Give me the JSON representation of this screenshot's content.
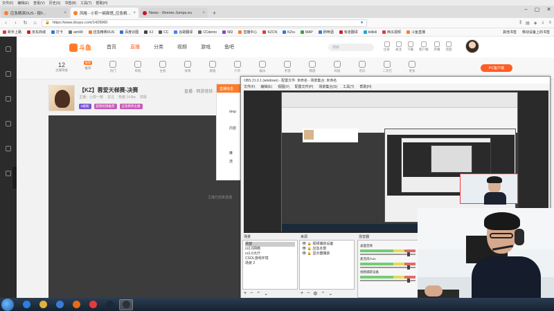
{
  "menubar": {
    "items": [
      "文件(F)",
      "编辑(E)",
      "查看(V)",
      "历史(S)",
      "书签(B)",
      "工具(T)",
      "帮助(H)"
    ]
  },
  "tabs": [
    {
      "label": "应急精英DUS - 按F...",
      "color": "#ff7b27",
      "active": false
    },
    {
      "label": "风格 - 小煎一碗面馆_应急精英...",
      "color": "#ff7b27",
      "active": true
    },
    {
      "label": "News - Xtreme-Jumps.eu",
      "color": "#c8102e",
      "active": false
    }
  ],
  "nav": {
    "url": "https://www.douyu.com/1429960",
    "back": "‹",
    "forward": "›",
    "reload": "↻",
    "home": "⌂",
    "new_tab": "+"
  },
  "bookmarks": {
    "items": [
      {
        "label": "新手上路",
        "color": "#e23b3b"
      },
      {
        "label": "京东商城",
        "color": "#d71e1e"
      },
      {
        "label": "打卡",
        "color": "#2f7bd9"
      },
      {
        "label": "aim99",
        "color": "#777777"
      },
      {
        "label": "应急精英DUS",
        "color": "#ff7b27"
      },
      {
        "label": "百度识图",
        "color": "#3a6fd8"
      },
      {
        "label": "XJ",
        "color": "#444444"
      },
      {
        "label": "CC",
        "color": "#5a5a5a"
      },
      {
        "label": "谷歌翻译",
        "color": "#4285f4"
      },
      {
        "label": "CCdemo",
        "color": "#6b6b6b"
      },
      {
        "label": "582",
        "color": "#8b3dd6"
      },
      {
        "label": "直播中心",
        "color": "#ff7b27"
      },
      {
        "label": "KZCN",
        "color": "#e23b3b"
      },
      {
        "label": "KZru",
        "color": "#2f7bd9"
      },
      {
        "label": "MAP",
        "color": "#3aa14a"
      },
      {
        "label": "刷啤酒",
        "color": "#2f7bd9"
      },
      {
        "label": "有道翻译",
        "color": "#d71e1e"
      },
      {
        "label": "bilibili",
        "color": "#22a6d8"
      },
      {
        "label": "西瓜视频",
        "color": "#e23b3b"
      },
      {
        "label": "斗鱼直播",
        "color": "#ff7b27"
      }
    ],
    "right": [
      "其他书签",
      "移动设备上的书签"
    ]
  },
  "douyu": {
    "logo": "斗鱼",
    "nav": [
      "首页",
      "直播",
      "分类",
      "视频",
      "游戏",
      "鱼吧"
    ],
    "active_nav": "直播",
    "search_placeholder": "搜索",
    "header_icons": [
      "历史",
      "关注",
      "下载",
      "客户端",
      "开播",
      "消息"
    ],
    "stat_number": "12",
    "stat_label": "主播等级",
    "categories": [
      "推荐",
      "热门",
      "单机",
      "主机",
      "体育",
      "颜值",
      "户外",
      "娱乐",
      "手游",
      "网游",
      "科技",
      "音乐",
      "二次元",
      "更多"
    ],
    "recommend_badge": "推荐",
    "pc_button": "PC客户端",
    "room_title": "【KZ】蓉爱天梯赛-决赛",
    "room_title_right": "直播 · 网游竞技 · 反恐精英",
    "room_meta": [
      "主播：小煎一碗",
      "关注",
      "热度 14.8w",
      "举报"
    ],
    "room_tags": [
      {
        "label": "5级粉",
        "color": "#7a55d6"
      },
      {
        "label": "超管权限推荐",
        "color": "#c85ab5"
      },
      {
        "label": "应急精英主播",
        "color": "#c85ab5"
      }
    ],
    "dialog_header": "直播信息",
    "dialog_lines": [
      "rtmp",
      "",
      "内容",
      "",
      "",
      "推",
      "流"
    ],
    "share_text": "主播已结束直播"
  },
  "obs": {
    "title": "OBS 21.0.1 (windows) - 配置文件: 未命名 - 场景集合: 未命名",
    "menu": [
      "文件(F)",
      "编辑(E)",
      "视图(V)",
      "配置文件(P)",
      "场景集合(S)",
      "工具(T)",
      "帮助(H)"
    ],
    "scenes_header": "场景",
    "scenes": [
      "桌面",
      "cs1.6网络",
      "cs1.6大厅",
      "CSOL游戏环境",
      "场景 2"
    ],
    "sources_header": "来源",
    "sources": [
      "视频捕获设备",
      "应急本部",
      "显示器捕获"
    ],
    "mixer_header": "混音器",
    "mixer_channels": [
      "桌面音频",
      "麦克风/Aux",
      "视频捕获设备"
    ]
  },
  "taskbar": {
    "items": [
      {
        "name": "start",
        "color": "#1d5fa8"
      },
      {
        "name": "ie",
        "color": "#2a7de1"
      },
      {
        "name": "explorer",
        "color": "#e1b33a"
      },
      {
        "name": "onedrive",
        "color": "#3a7bd5"
      },
      {
        "name": "firefox",
        "color": "#e66a17"
      },
      {
        "name": "chrome",
        "color": "#e33b3b"
      },
      {
        "name": "steam",
        "color": "#1b2838"
      },
      {
        "name": "obs",
        "color": "#303030"
      }
    ]
  }
}
